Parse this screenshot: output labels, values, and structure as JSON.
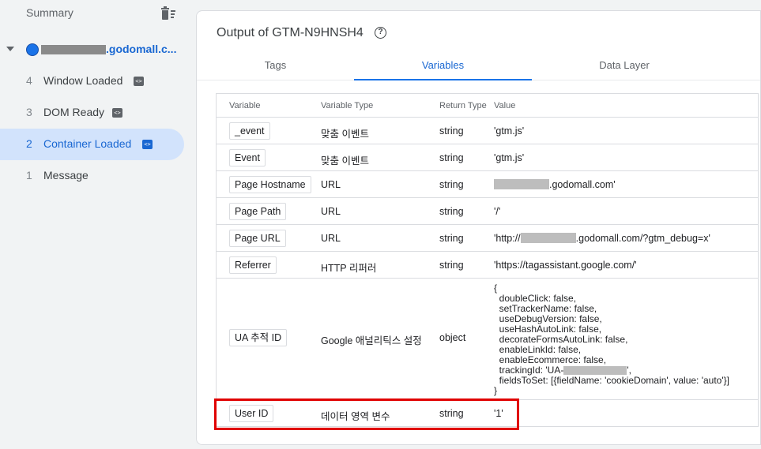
{
  "sidebar": {
    "summary_label": "Summary",
    "container_name": ".godomall.c...",
    "events": [
      {
        "num": "4",
        "label": "Window Loaded"
      },
      {
        "num": "3",
        "label": "DOM Ready"
      },
      {
        "num": "2",
        "label": "Container Loaded"
      },
      {
        "num": "1",
        "label": "Message"
      }
    ]
  },
  "panel": {
    "title": "Output of GTM-N9HNSH4",
    "help": "?",
    "tabs": [
      "Tags",
      "Variables",
      "Data Layer"
    ],
    "active_tab": "Variables"
  },
  "table": {
    "headers": [
      "Variable",
      "Variable Type",
      "Return Type",
      "Value"
    ],
    "rows": [
      {
        "variable": "_event",
        "type": "맞춤 이벤트",
        "return": "string",
        "value": "'gtm.js'"
      },
      {
        "variable": "Event",
        "type": "맞춤 이벤트",
        "return": "string",
        "value": "'gtm.js'"
      },
      {
        "variable": "Page Hostname",
        "type": "URL",
        "return": "string",
        "value_pre": "",
        "value_post": ".godomall.com'"
      },
      {
        "variable": "Page Path",
        "type": "URL",
        "return": "string",
        "value": "'/'"
      },
      {
        "variable": "Page URL",
        "type": "URL",
        "return": "string",
        "value_pre": "'http://",
        "value_post": ".godomall.com/?gtm_debug=x'"
      },
      {
        "variable": "Referrer",
        "type": "HTTP 리퍼러",
        "return": "string",
        "value": "'https://tagassistant.google.com/'"
      },
      {
        "variable": "UA 추적 ID",
        "type": "Google 애널리틱스 설정",
        "return": "object",
        "value_lines": [
          "{",
          "  doubleClick: false,",
          "  setTrackerName: false,",
          "  useDebugVersion: false,",
          "  useHashAutoLink: false,",
          "  decorateFormsAutoLink: false,",
          "  enableLinkId: false,",
          "  enableEcommerce: false,",
          "  trackingId: 'UA-",
          "  fieldsToSet: [{fieldName: 'cookieDomain', value: 'auto'}]",
          "}"
        ],
        "tracking_suffix": "',"
      },
      {
        "variable": "User ID",
        "type": "데이터 영역 변수",
        "return": "string",
        "value": "'1'"
      }
    ]
  },
  "colors": {
    "accent": "#1a73e8",
    "highlight": "#e00000",
    "active_bg": "#d2e3fc"
  }
}
